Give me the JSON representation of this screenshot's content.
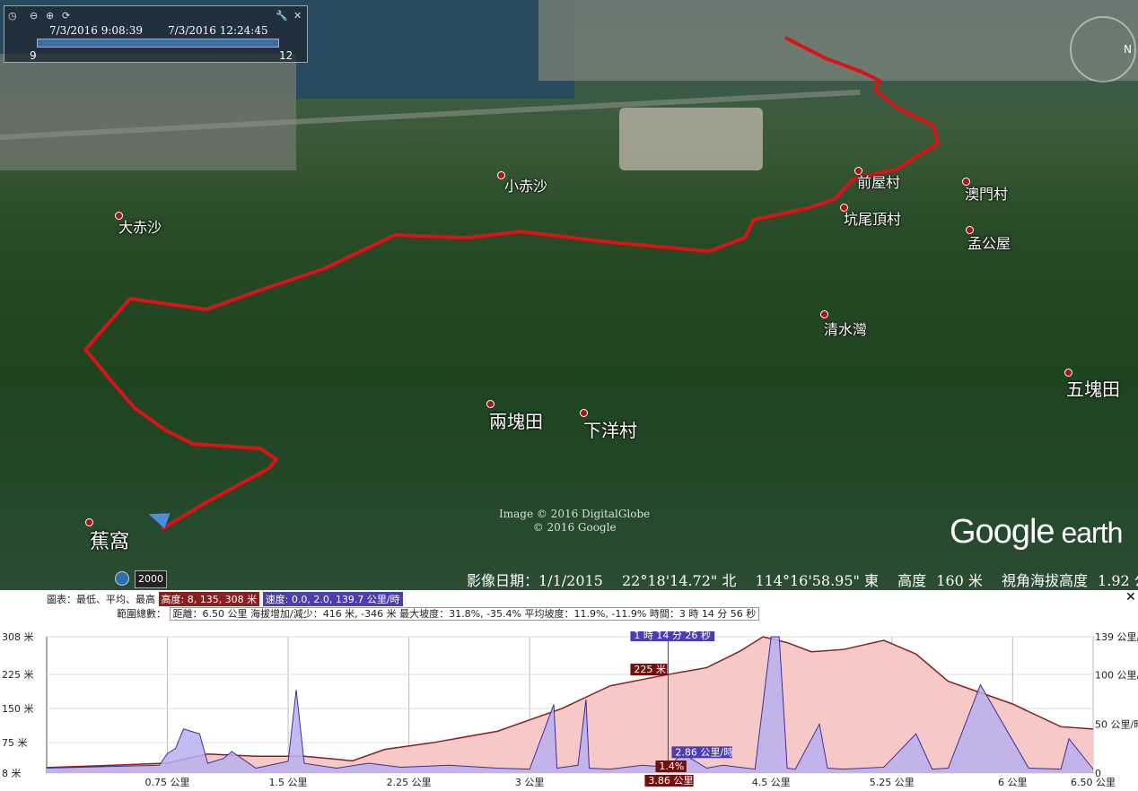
{
  "map": {
    "places": [
      {
        "name": "小赤沙",
        "size": "normal"
      },
      {
        "name": "大赤沙",
        "size": "normal"
      },
      {
        "name": "前屋村",
        "size": "normal"
      },
      {
        "name": "澳門村",
        "size": "normal"
      },
      {
        "name": "坑尾頂村",
        "size": "normal"
      },
      {
        "name": "孟公屋",
        "size": "normal"
      },
      {
        "name": "清水灣",
        "size": "normal"
      },
      {
        "name": "兩塊田",
        "size": "normal"
      },
      {
        "name": "下洋村",
        "size": "normal"
      },
      {
        "name": "五塊田",
        "size": "normal"
      },
      {
        "name": "蕉窩",
        "size": "big"
      }
    ],
    "copyright_line1": "Image © 2016 DigitalGlobe",
    "copyright_line2": "© 2016 Google",
    "logo_main": "Google",
    "logo_sub": " earth",
    "compass_label": "N",
    "track_color": "#d81414"
  },
  "time_slider": {
    "start": "7/3/2016   9:08:39",
    "end": "7/3/2016   12:24:45",
    "left_num": "9",
    "right_num": "12",
    "icons": [
      "clock-icon",
      "zoom-out-icon",
      "zoom-in-icon",
      "settings-icon",
      "wrench-icon",
      "close-icon"
    ]
  },
  "status": {
    "altitude_badge": "2000",
    "image_date": "影像日期：1/1/2015",
    "lat": "22°18'14.72\" 北",
    "lon": "114°16'58.95\" 東",
    "elev_label": "高度",
    "elev_value": "160 米",
    "eye_label": "視角海拔高度",
    "eye_value": "1.92 公里"
  },
  "profile": {
    "row1_label": "圖表：最低、平均、最高",
    "elev_pill": "高度: 8, 135, 308 米",
    "speed_pill": "速度: 0.0, 2.0, 139.7 公里/時",
    "row2_label": "範圍總數：",
    "summary": "距離：6.50 公里 海拔增加/減少：416 米, -346 米 最大坡度：31.8%, -35.4% 平均坡度：11.9%, -11.9% 時間：3 時 14 分 56 秒",
    "close": "✕",
    "cursor_time": "1 時 14 分 26 秒",
    "cursor_elev": "225 米",
    "cursor_speed": "2.86 公里/時",
    "cursor_grade": "1.4%",
    "cursor_dist": "3.86 公里"
  },
  "chart_data": {
    "type": "area",
    "x_unit": "公里",
    "xticks": [
      "0.75 公里",
      "1.5 公里",
      "2.25 公里",
      "3 公里",
      "4.5 公里",
      "5.25 公里",
      "6 公里",
      "6.50 公里"
    ],
    "xtick_values": [
      0.75,
      1.5,
      2.25,
      3,
      4.5,
      5.25,
      6,
      6.5
    ],
    "xlim": [
      0,
      6.5
    ],
    "left_yticks": [
      "308 米",
      "225 米",
      "150 米",
      "75 米",
      "8 米"
    ],
    "left_ytick_values": [
      308,
      225,
      150,
      75,
      8
    ],
    "right_yticks": [
      "139 公里/時",
      "100 公里/時",
      "50 公里/時",
      "0"
    ],
    "right_ytick_values": [
      139,
      100,
      50,
      0
    ],
    "ylim_left": [
      8,
      308
    ],
    "ylim_right": [
      0,
      139
    ],
    "cursor_x": 3.86,
    "series": [
      {
        "name": "高度",
        "color": "#8b1e1e",
        "fill": "#f6c8c8",
        "x": [
          0,
          0.4,
          0.75,
          1.0,
          1.3,
          1.6,
          1.9,
          2.1,
          2.4,
          2.8,
          3.2,
          3.5,
          3.86,
          4.1,
          4.3,
          4.45,
          4.6,
          4.75,
          4.95,
          5.2,
          5.4,
          5.6,
          6.0,
          6.3,
          6.5
        ],
        "y": [
          20,
          25,
          30,
          50,
          45,
          45,
          35,
          60,
          75,
          100,
          150,
          200,
          225,
          240,
          275,
          308,
          295,
          275,
          280,
          300,
          270,
          210,
          160,
          110,
          105
        ]
      },
      {
        "name": "速度",
        "color": "#3a2fa0",
        "fill": "#b8b0ef",
        "x": [
          0,
          0.7,
          0.75,
          0.8,
          0.85,
          0.95,
          1.0,
          1.1,
          1.15,
          1.3,
          1.5,
          1.55,
          1.6,
          1.8,
          2.0,
          2.2,
          2.5,
          2.8,
          3.0,
          3.15,
          3.17,
          3.3,
          3.35,
          3.37,
          3.5,
          3.7,
          3.86,
          3.95,
          4.1,
          4.2,
          4.4,
          4.5,
          4.55,
          4.6,
          4.65,
          4.8,
          4.85,
          4.95,
          5.2,
          5.4,
          5.5,
          5.6,
          5.8,
          6.1,
          6.3,
          6.35,
          6.5
        ],
        "y": [
          5,
          8,
          20,
          25,
          45,
          40,
          10,
          15,
          22,
          5,
          12,
          85,
          10,
          5,
          10,
          6,
          8,
          5,
          4,
          70,
          5,
          8,
          75,
          5,
          4,
          8,
          6,
          20,
          5,
          8,
          4,
          139,
          139,
          5,
          4,
          50,
          5,
          4,
          6,
          40,
          4,
          5,
          90,
          5,
          4,
          35,
          4
        ]
      }
    ]
  }
}
